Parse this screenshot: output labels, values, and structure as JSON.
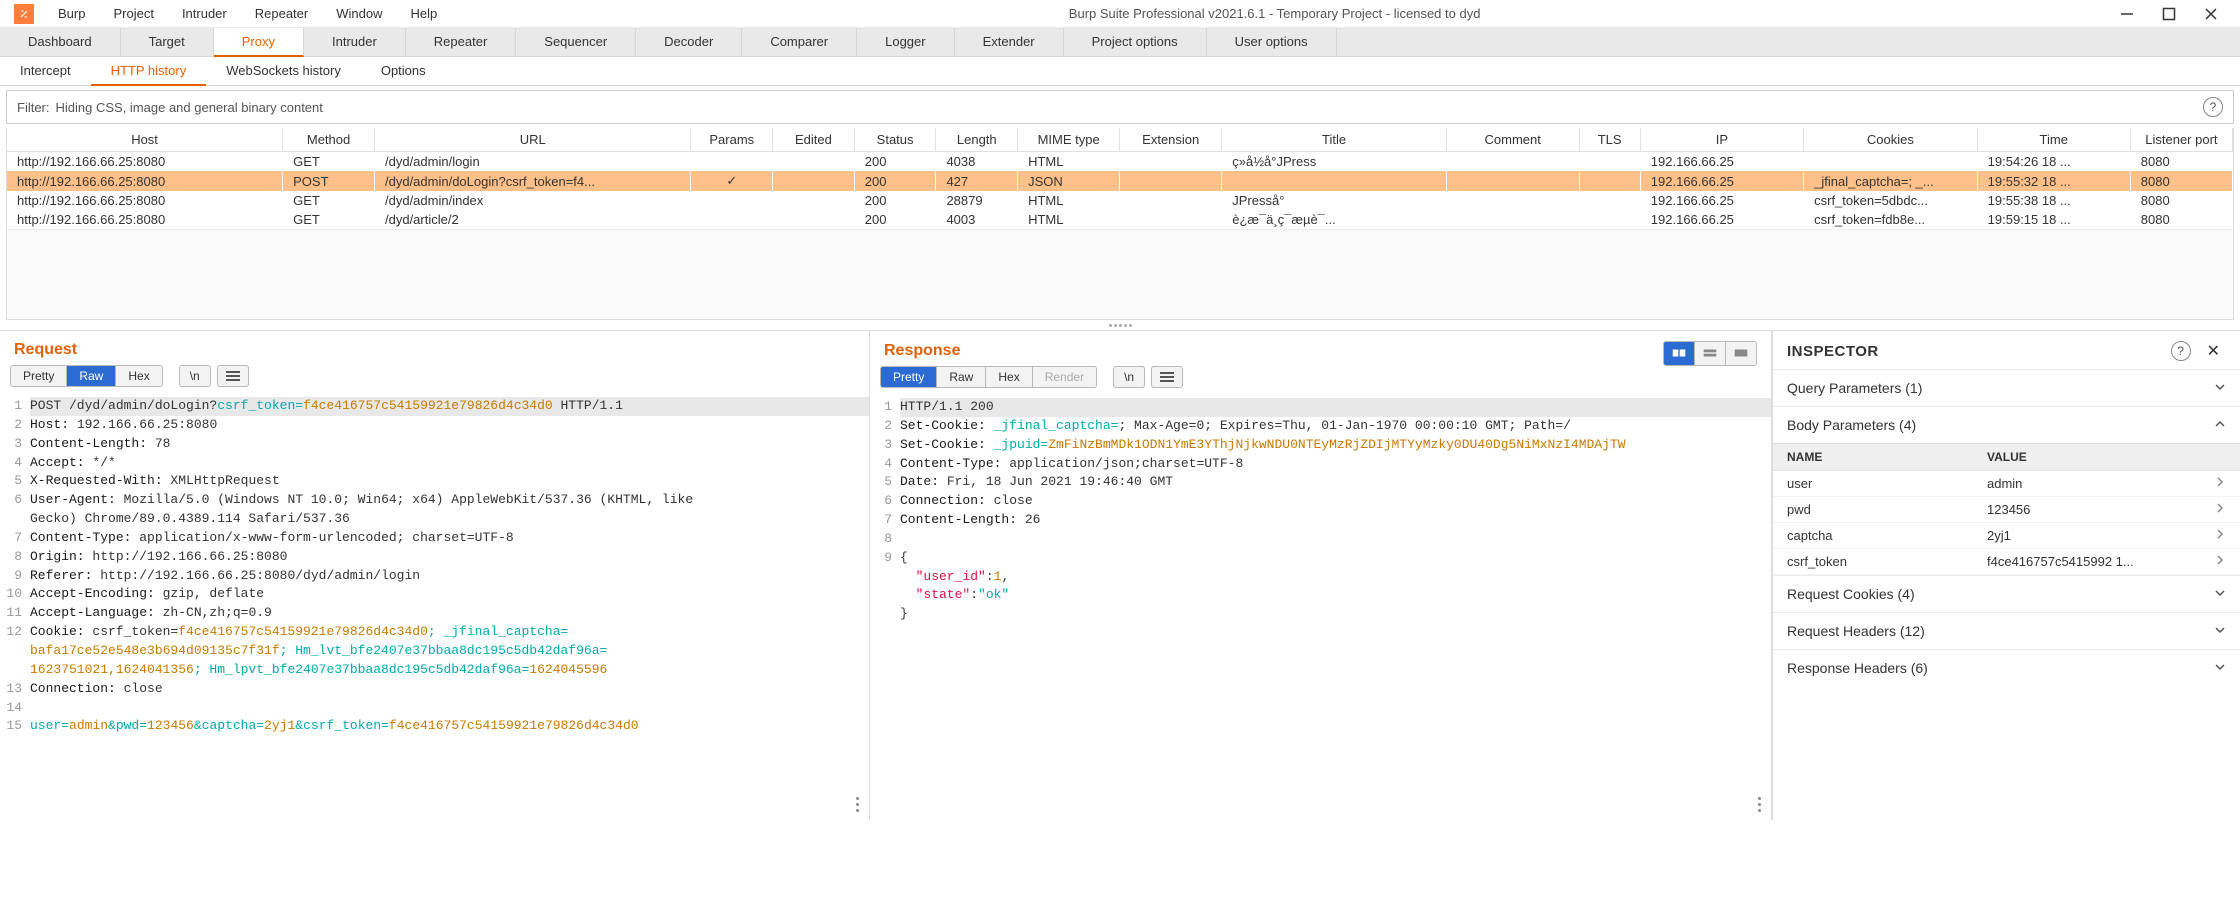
{
  "window": {
    "title": "Burp Suite Professional v2021.6.1 - Temporary Project - licensed to dyd"
  },
  "menu": [
    "Burp",
    "Project",
    "Intruder",
    "Repeater",
    "Window",
    "Help"
  ],
  "main_tabs": [
    "Dashboard",
    "Target",
    "Proxy",
    "Intruder",
    "Repeater",
    "Sequencer",
    "Decoder",
    "Comparer",
    "Logger",
    "Extender",
    "Project options",
    "User options"
  ],
  "main_tab_active": "Proxy",
  "sub_tabs": [
    "Intercept",
    "HTTP history",
    "WebSockets history",
    "Options"
  ],
  "sub_tab_active": "HTTP history",
  "filter": {
    "label": "Filter:",
    "text": "Hiding CSS, image and general binary content"
  },
  "history": {
    "columns": [
      "Host",
      "Method",
      "URL",
      "Params",
      "Edited",
      "Status",
      "Length",
      "MIME type",
      "Extension",
      "Title",
      "Comment",
      "TLS",
      "IP",
      "Cookies",
      "Time",
      "Listener port"
    ],
    "rows": [
      {
        "host": "http://192.166.66.25:8080",
        "method": "GET",
        "url": "/dyd/admin/login",
        "params": "",
        "edited": "",
        "status": "200",
        "length": "4038",
        "mime": "HTML",
        "ext": "",
        "title": "ç»å½å°JPress",
        "comment": "",
        "tls": "",
        "ip": "192.166.66.25",
        "cookies": "",
        "time": "19:54:26 18 ...",
        "port": "8080"
      },
      {
        "host": "http://192.166.66.25:8080",
        "method": "POST",
        "url": "/dyd/admin/doLogin?csrf_token=f4...",
        "params": "✓",
        "edited": "",
        "status": "200",
        "length": "427",
        "mime": "JSON",
        "ext": "",
        "title": "",
        "comment": "",
        "tls": "",
        "ip": "192.166.66.25",
        "cookies": "_jfinal_captcha=; _...",
        "time": "19:55:32 18 ...",
        "port": "8080",
        "selected": true
      },
      {
        "host": "http://192.166.66.25:8080",
        "method": "GET",
        "url": "/dyd/admin/index",
        "params": "",
        "edited": "",
        "status": "200",
        "length": "28879",
        "mime": "HTML",
        "ext": "",
        "title": "JPresså°",
        "comment": "",
        "tls": "",
        "ip": "192.166.66.25",
        "cookies": "csrf_token=5dbdc...",
        "time": "19:55:38 18 ...",
        "port": "8080"
      },
      {
        "host": "http://192.166.66.25:8080",
        "method": "GET",
        "url": "/dyd/article/2",
        "params": "",
        "edited": "",
        "status": "200",
        "length": "4003",
        "mime": "HTML",
        "ext": "",
        "title": "è¿æ¯ä¸ç¯æµè¯...",
        "comment": "",
        "tls": "",
        "ip": "192.166.66.25",
        "cookies": "csrf_token=fdb8e...",
        "time": "19:59:15 18 ...",
        "port": "8080"
      }
    ]
  },
  "request": {
    "title": "Request",
    "tabs": [
      "Pretty",
      "Raw",
      "Hex"
    ],
    "active_tab": "Raw",
    "newline_btn": "\\n",
    "lines": [
      {
        "n": 1,
        "first": true,
        "segs": [
          {
            "t": "POST /dyd/admin/doLogin?"
          },
          {
            "t": "csrf_token=",
            "c": "tok-url"
          },
          {
            "t": "f4ce416757c54159921e79826d4c34d0",
            "c": "tok-hl"
          },
          {
            "t": " HTTP/1.1"
          }
        ]
      },
      {
        "n": 2,
        "segs": [
          {
            "t": "Host:",
            "c": "tok-key"
          },
          {
            "t": " 192.166.66.25:8080"
          }
        ]
      },
      {
        "n": 3,
        "segs": [
          {
            "t": "Content-Length:",
            "c": "tok-key"
          },
          {
            "t": " 78"
          }
        ]
      },
      {
        "n": 4,
        "segs": [
          {
            "t": "Accept:",
            "c": "tok-key"
          },
          {
            "t": " */*"
          }
        ]
      },
      {
        "n": 5,
        "segs": [
          {
            "t": "X-Requested-With:",
            "c": "tok-key"
          },
          {
            "t": " XMLHttpRequest"
          }
        ]
      },
      {
        "n": 6,
        "segs": [
          {
            "t": "User-Agent:",
            "c": "tok-key"
          },
          {
            "t": " Mozilla/5.0 (Windows NT 10.0; Win64; x64) AppleWebKit/537.36 (KHTML, like"
          }
        ]
      },
      {
        "n": "",
        "segs": [
          {
            "t": "Gecko) Chrome/89.0.4389.114 Safari/537.36"
          }
        ]
      },
      {
        "n": 7,
        "segs": [
          {
            "t": "Content-Type:",
            "c": "tok-key"
          },
          {
            "t": " application/x-www-form-urlencoded; charset=UTF-8"
          }
        ]
      },
      {
        "n": 8,
        "segs": [
          {
            "t": "Origin:",
            "c": "tok-key"
          },
          {
            "t": " http://192.166.66.25:8080"
          }
        ]
      },
      {
        "n": 9,
        "segs": [
          {
            "t": "Referer:",
            "c": "tok-key"
          },
          {
            "t": " http://192.166.66.25:8080/dyd/admin/login"
          }
        ]
      },
      {
        "n": 10,
        "segs": [
          {
            "t": "Accept-Encoding:",
            "c": "tok-key"
          },
          {
            "t": " gzip, deflate"
          }
        ]
      },
      {
        "n": 11,
        "segs": [
          {
            "t": "Accept-Language:",
            "c": "tok-key"
          },
          {
            "t": " zh-CN,zh;q=0.9"
          }
        ]
      },
      {
        "n": 12,
        "segs": [
          {
            "t": "Cookie:",
            "c": "tok-key"
          },
          {
            "t": " csrf_token="
          },
          {
            "t": "f4ce416757c54159921e79826d4c34d0",
            "c": "tok-hl"
          },
          {
            "t": "; _jfinal_captcha=",
            "c": "tok-url"
          }
        ]
      },
      {
        "n": "",
        "segs": [
          {
            "t": "bafa17ce52e548e3b694d09135c7f31f",
            "c": "tok-hl"
          },
          {
            "t": "; Hm_lvt_bfe2407e37bbaa8dc195c5db42daf96a=",
            "c": "tok-url"
          }
        ]
      },
      {
        "n": "",
        "segs": [
          {
            "t": "1623751021,1624041356",
            "c": "tok-hl"
          },
          {
            "t": "; Hm_lpvt_bfe2407e37bbaa8dc195c5db42daf96a=",
            "c": "tok-url"
          },
          {
            "t": "1624045596",
            "c": "tok-hl"
          }
        ]
      },
      {
        "n": 13,
        "segs": [
          {
            "t": "Connection:",
            "c": "tok-key"
          },
          {
            "t": " close"
          }
        ]
      },
      {
        "n": 14,
        "segs": [
          {
            "t": ""
          }
        ]
      },
      {
        "n": 15,
        "segs": [
          {
            "t": "user=",
            "c": "tok-url"
          },
          {
            "t": "admin",
            "c": "tok-hl"
          },
          {
            "t": "&pwd=",
            "c": "tok-url"
          },
          {
            "t": "123456",
            "c": "tok-hl"
          },
          {
            "t": "&captcha=",
            "c": "tok-url"
          },
          {
            "t": "2yj1",
            "c": "tok-hl"
          },
          {
            "t": "&csrf_token=",
            "c": "tok-url"
          },
          {
            "t": "f4ce416757c54159921e79826d4c34d0",
            "c": "tok-hl"
          }
        ]
      }
    ]
  },
  "response": {
    "title": "Response",
    "tabs": [
      "Pretty",
      "Raw",
      "Hex",
      "Render"
    ],
    "active_tab": "Pretty",
    "newline_btn": "\\n",
    "lines": [
      {
        "n": 1,
        "first": true,
        "segs": [
          {
            "t": "HTTP/1.1 200"
          }
        ]
      },
      {
        "n": 2,
        "segs": [
          {
            "t": "Set-Cookie:",
            "c": "tok-key"
          },
          {
            "t": " _jfinal_captcha=",
            "c": "tok-url"
          },
          {
            "t": "; Max-Age=0; Expires=Thu, 01-Jan-1970 00:00:10 GMT; Path=/"
          }
        ]
      },
      {
        "n": 3,
        "segs": [
          {
            "t": "Set-Cookie:",
            "c": "tok-key"
          },
          {
            "t": " _jpuid=",
            "c": "tok-url"
          },
          {
            "t": "ZmFiNzBmMDk1ODN1YmE3YThjNjkwNDU0NTEyMzRjZDIjMTYyMzky0DU40Dg5NiMxNzI4MDAjTW",
            "c": "tok-hl"
          }
        ]
      },
      {
        "n": 4,
        "segs": [
          {
            "t": "Content-Type:",
            "c": "tok-key"
          },
          {
            "t": " application/json;charset=UTF-8"
          }
        ]
      },
      {
        "n": 5,
        "segs": [
          {
            "t": "Date:",
            "c": "tok-key"
          },
          {
            "t": " Fri, 18 Jun 2021 19:46:40 GMT"
          }
        ]
      },
      {
        "n": 6,
        "segs": [
          {
            "t": "Connection:",
            "c": "tok-key"
          },
          {
            "t": " close"
          }
        ]
      },
      {
        "n": 7,
        "segs": [
          {
            "t": "Content-Length:",
            "c": "tok-key"
          },
          {
            "t": " 26"
          }
        ]
      },
      {
        "n": 8,
        "segs": [
          {
            "t": ""
          }
        ]
      },
      {
        "n": 9,
        "segs": [
          {
            "t": "{"
          }
        ]
      },
      {
        "n": "",
        "segs": [
          {
            "t": "  \"user_id\"",
            "c": "tok-val"
          },
          {
            "t": ":"
          },
          {
            "t": "1",
            "c": "tok-num"
          },
          {
            "t": ","
          }
        ]
      },
      {
        "n": "",
        "segs": [
          {
            "t": "  \"state\"",
            "c": "tok-val"
          },
          {
            "t": ":"
          },
          {
            "t": "\"ok\"",
            "c": "tok-url"
          }
        ]
      },
      {
        "n": "",
        "segs": [
          {
            "t": "}"
          }
        ]
      }
    ]
  },
  "inspector": {
    "title": "INSPECTOR",
    "sections": {
      "query": "Query Parameters (1)",
      "body": "Body Parameters (4)",
      "cookies": "Request Cookies (4)",
      "req_headers": "Request Headers (12)",
      "resp_headers": "Response Headers (6)"
    },
    "body_table": {
      "h_name": "NAME",
      "h_value": "VALUE",
      "rows": [
        {
          "name": "user",
          "value": "admin"
        },
        {
          "name": "pwd",
          "value": "123456"
        },
        {
          "name": "captcha",
          "value": "2yj1"
        },
        {
          "name": "csrf_token",
          "value": "f4ce416757c5415992 1..."
        }
      ]
    }
  }
}
